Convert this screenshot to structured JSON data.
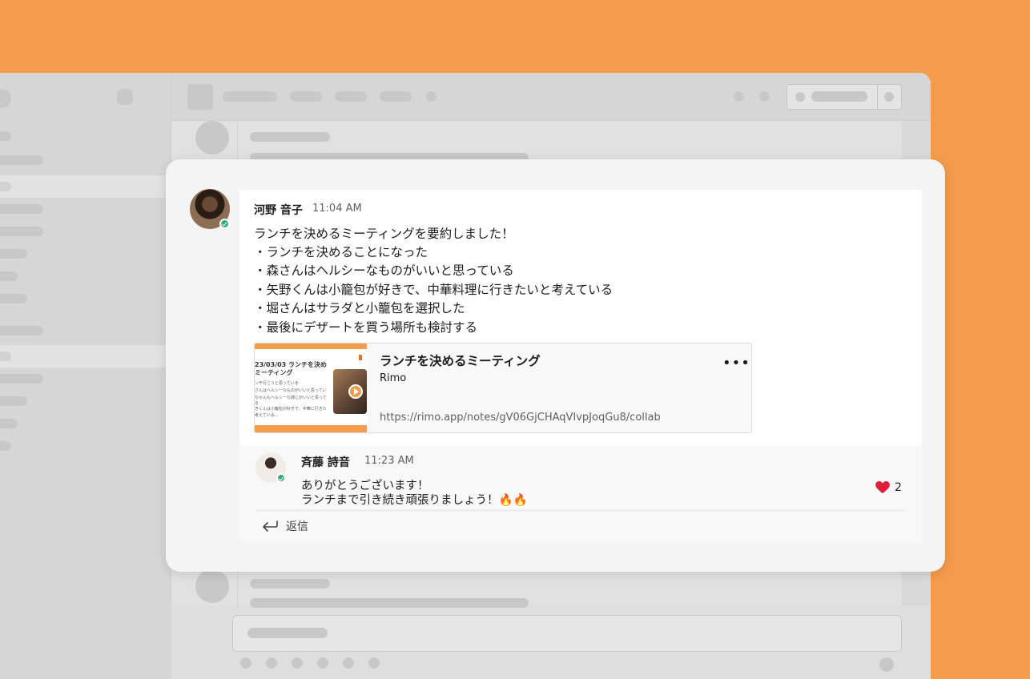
{
  "message": {
    "author": "河野 音子",
    "time": "11:04 AM",
    "lines": [
      "ランチを決めるミーティングを要約しました！",
      "・ランチを決めることになった",
      "・森さんはヘルシーなものがいいと思っている",
      "・矢野くんは小籠包が好きで、中華料理に行きたいと考えている",
      "・堀さんはサラダと小籠包を選択した",
      "・最後にデザートを買う場所も検討する"
    ],
    "unfurl": {
      "title": "ランチを決めるミーティング",
      "source": "Rimo",
      "url": "https://rimo.app/notes/gV06GjCHAqVIvpJoqGu8/collab",
      "more_label": "•••",
      "thumbnail": {
        "title_line1": "23/03/03 ランチを決め",
        "title_line2": "ミーティング",
        "lines": [
          "ンチ行こうと思っている",
          "さんはヘルシーなものがいいと思っている",
          "ちゃんもヘルシーな感じがいいと思って",
          "る",
          "きくんは小籠包が好きで、中華に行きたい",
          "考えている..."
        ]
      }
    }
  },
  "reply": {
    "author": "斉藤 詩音",
    "time": "11:23 AM",
    "line1": "ありがとうございます！",
    "line2": "ランチまで引き続き頑張りましょう！🔥🔥",
    "reaction_count": "2",
    "reply_label": "返信"
  },
  "colors": {
    "background": "#F39C4B",
    "online_status": "#2bac76",
    "heart": "#e01e3c"
  },
  "icons": {
    "reaction": "heart-icon",
    "reply": "reply-arrow-icon",
    "more": "more-horizontal-icon",
    "play": "play-icon",
    "status": "online-status-icon"
  }
}
